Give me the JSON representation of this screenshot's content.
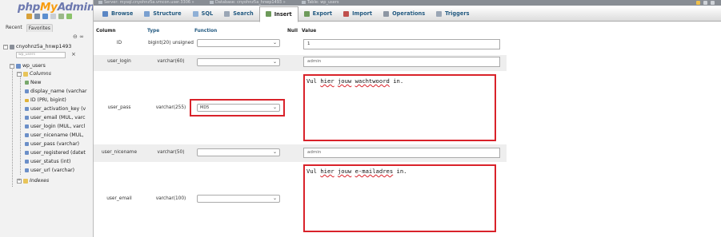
{
  "logo": {
    "php": "php",
    "my": "My",
    "admin": "Admin"
  },
  "sidebar": {
    "tabs": [
      "Recent",
      "Favorites"
    ],
    "collapse": "⊖ ∞",
    "filter_placeholder": "wp_users",
    "filter_clear": "×",
    "db_name": "cnyohnz5a_hnwp1493",
    "table_name": "wp_users",
    "columns_label": "Columns",
    "new_label": "New",
    "columns": [
      "display_name (varchar",
      "ID (PRI, bigint)",
      "user_activation_key (v",
      "user_email (MUL, varc",
      "user_login (MUL, varcl",
      "user_nicename (MUL,",
      "user_pass (varchar)",
      "user_registered (datet",
      "user_status (int)",
      "user_url (varchar)"
    ],
    "indexes_label": "Indexes"
  },
  "topbar": {
    "crumbs": [
      "Server: mysql.cnyohnz5a.vmcon.user.3306 »",
      "Database: cnyohnz5a_hnwp1493 »",
      "Table: wp_users"
    ]
  },
  "menu": {
    "tabs": [
      {
        "label": "Browse",
        "color": "#5a86c4"
      },
      {
        "label": "Structure",
        "color": "#7aa0d0"
      },
      {
        "label": "SQL",
        "color": "#8fb0d6"
      },
      {
        "label": "Search",
        "color": "#9aa6b5"
      },
      {
        "label": "Insert",
        "color": "#6d9a5a"
      },
      {
        "label": "Export",
        "color": "#6d9a5a"
      },
      {
        "label": "Import",
        "color": "#c0504d"
      },
      {
        "label": "Operations",
        "color": "#8d96a3"
      },
      {
        "label": "Triggers",
        "color": "#9aa6b5"
      }
    ],
    "active": "Insert"
  },
  "form": {
    "headers": {
      "column": "Column",
      "type": "Type",
      "function": "Function",
      "null": "Null",
      "value": "Value"
    },
    "rows": [
      {
        "column": "ID",
        "type": "bigint(20) unsigned",
        "function": "",
        "value": "1"
      },
      {
        "column": "user_login",
        "type": "varchar(60)",
        "function": "",
        "value": "admin"
      },
      {
        "column": "user_pass",
        "type": "varchar(255)",
        "function": "MD5",
        "value_words": [
          "Vul",
          "hier",
          "jouw",
          "wachtwoord",
          "in."
        ]
      },
      {
        "column": "user_nicename",
        "type": "varchar(50)",
        "function": "",
        "value": "admin"
      },
      {
        "column": "user_email",
        "type": "varchar(100)",
        "function": "",
        "value_words": [
          "Vul",
          "hier",
          "jouw",
          "e-mailadres",
          "in."
        ]
      }
    ],
    "highlight_color": "#d9222a"
  }
}
